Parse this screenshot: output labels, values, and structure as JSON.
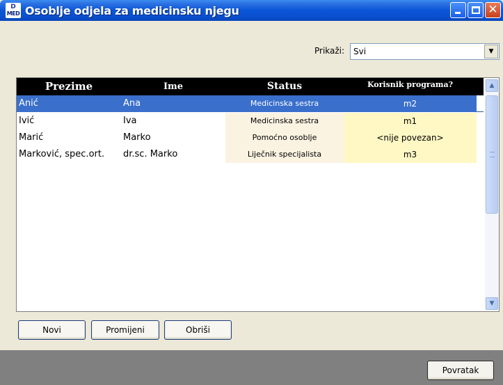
{
  "window": {
    "title": "Osoblje odjela za medicinsku njegu",
    "logo_top": "D",
    "logo_bottom": "MED"
  },
  "filter": {
    "label": "Prikaži:",
    "value": "Svi"
  },
  "table": {
    "headers": [
      "Prezime",
      "Ime",
      "Status",
      "Korisnik programa?"
    ],
    "rows": [
      {
        "prezime": "Anić",
        "ime": "Ana",
        "status": "Medicinska sestra",
        "korisnik": "m2",
        "selected": true
      },
      {
        "prezime": "Ivić",
        "ime": "Iva",
        "status": "Medicinska sestra",
        "korisnik": "m1",
        "selected": false
      },
      {
        "prezime": "Marić",
        "ime": "Marko",
        "status": "Pomoćno osoblje",
        "korisnik": "<nije povezan>",
        "selected": false
      },
      {
        "prezime": "Marković, spec.ort.",
        "ime": "dr.sc. Marko",
        "status": "Liječnik specijalista",
        "korisnik": "m3",
        "selected": false
      }
    ]
  },
  "actions": {
    "new_label": "Novi",
    "edit_label": "Promijeni",
    "delete_label": "Obriši",
    "back_label": "Povratak"
  },
  "colors": {
    "selected_row": "#3a6fcb",
    "status_cell": "#fbf3e2",
    "user_cell": "#fff8c4",
    "header_bg": "#000000",
    "bottom_bar": "#808080"
  }
}
